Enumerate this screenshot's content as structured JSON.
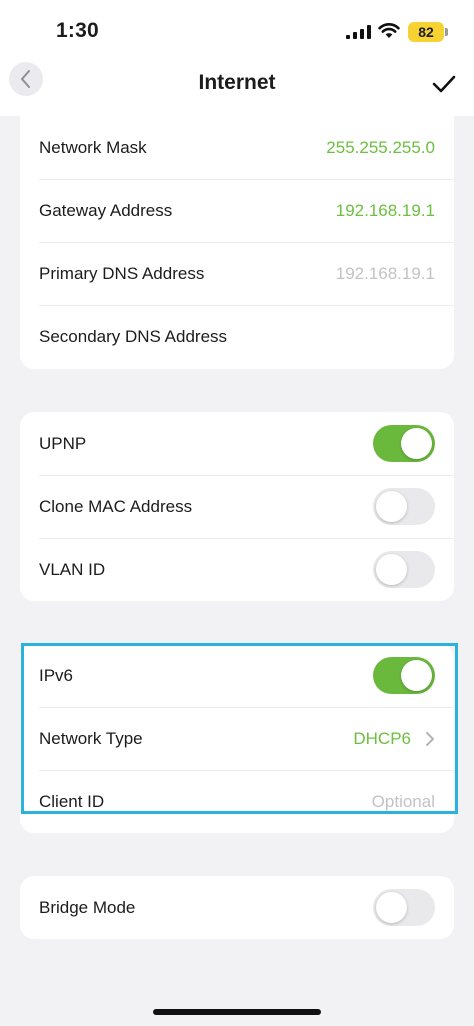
{
  "status_bar": {
    "time": "1:30",
    "battery": "82"
  },
  "nav": {
    "title": "Internet"
  },
  "network_card": {
    "rows": [
      {
        "label": "Network Mask",
        "value": "255.255.255.0"
      },
      {
        "label": "Gateway Address",
        "value": "192.168.19.1"
      },
      {
        "label": "Primary DNS Address",
        "placeholder": "192.168.19.1"
      },
      {
        "label": "Secondary DNS Address",
        "value": ""
      }
    ]
  },
  "toggles_card": {
    "rows": [
      {
        "label": "UPNP",
        "enabled": true
      },
      {
        "label": "Clone MAC Address",
        "enabled": false
      },
      {
        "label": "VLAN ID",
        "enabled": false
      }
    ]
  },
  "ipv6_card": {
    "ipv6_label": "IPv6",
    "ipv6_enabled": true,
    "network_type_label": "Network Type",
    "network_type_value": "DHCP6",
    "client_id_label": "Client ID",
    "client_id_placeholder": "Optional"
  },
  "bridge_card": {
    "label": "Bridge Mode",
    "enabled": false
  },
  "colors": {
    "accent_green": "#6ab93d",
    "value_green": "#6cbf3f",
    "highlight_blue": "#2bb3e0",
    "battery_yellow": "#f6d232"
  }
}
